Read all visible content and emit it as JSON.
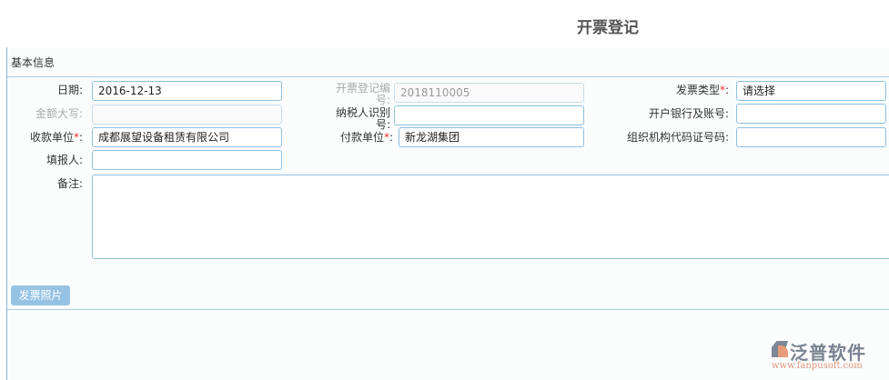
{
  "title": "开票登记",
  "section": "基本信息",
  "fields": {
    "date": {
      "label": "日期:",
      "value": "2016-12-13"
    },
    "invoice_no": {
      "label_a": "开票登记编",
      "label_b": "号:",
      "value": "2018110005"
    },
    "invoice_type": {
      "label": "发票类型",
      "suffix": ":",
      "value": "请选择"
    },
    "amount_words": {
      "label": "金额大写:",
      "value": ""
    },
    "taxpayer_id": {
      "label_a": "纳税人识别",
      "label_b": "号:",
      "value": ""
    },
    "bank_account": {
      "label": "开户银行及账号:",
      "value": ""
    },
    "payee": {
      "label": "收款单位",
      "suffix": ":",
      "value": "成都展望设备租赁有限公司"
    },
    "payer": {
      "label": "付款单位",
      "suffix": ":",
      "value": "新龙湖集团"
    },
    "org_code": {
      "label": "组织机构代码证号码:",
      "value": ""
    },
    "filled_by": {
      "label": "填报人:",
      "value": ""
    },
    "remark": {
      "label": "备注:",
      "value": ""
    }
  },
  "required_mark": "*",
  "photo_button": "发票照片",
  "logo": {
    "name": "泛普软件",
    "url": "www.fanpusoft.com"
  }
}
